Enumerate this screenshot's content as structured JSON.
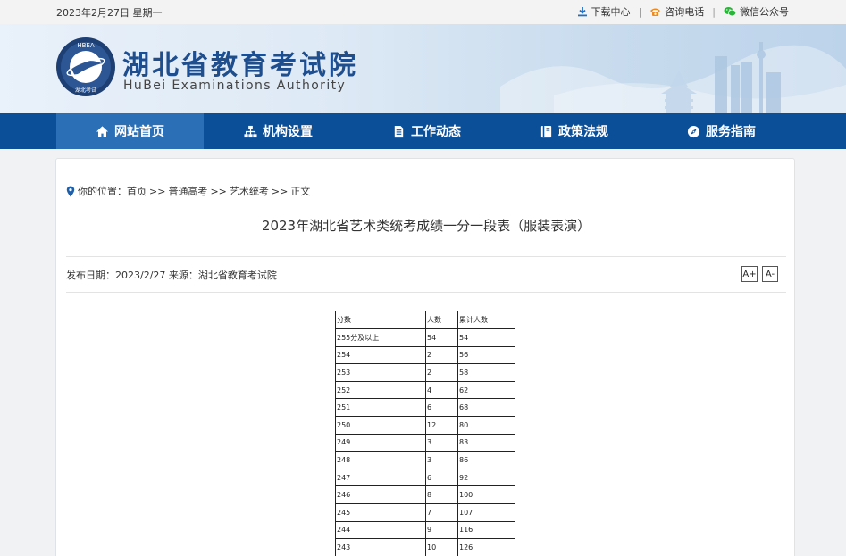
{
  "topbar": {
    "date": "2023年2月27日 星期一",
    "download_label": "下载中心",
    "phone_label": "咨询电话",
    "wechat_label": "微信公众号",
    "separator": "|"
  },
  "header": {
    "title_cn": "湖北省教育考试院",
    "title_en": "HuBei Examinations Authority",
    "logo_text_top": "HBEA",
    "logo_text_bottom": "湖北考试"
  },
  "nav": {
    "items": [
      {
        "label": "网站首页",
        "icon": "home-icon"
      },
      {
        "label": "机构设置",
        "icon": "org-chart-icon"
      },
      {
        "label": "工作动态",
        "icon": "document-icon"
      },
      {
        "label": "政策法规",
        "icon": "book-icon"
      },
      {
        "label": "服务指南",
        "icon": "compass-icon"
      }
    ]
  },
  "breadcrumb": {
    "prefix": "你的位置：",
    "items": [
      "首页",
      "普通高考",
      "艺术统考",
      "正文"
    ],
    "separator": ">>"
  },
  "article": {
    "title": "2023年湖北省艺术类统考成绩一分一段表（服装表演）",
    "meta": "发布日期：2023/2/27 来源：湖北省教育考试院",
    "font_increase": "A+",
    "font_decrease": "A-"
  },
  "table": {
    "headers": [
      "分数",
      "人数",
      "累计人数"
    ],
    "rows": [
      [
        "255分及以上",
        "54",
        "54"
      ],
      [
        "254",
        "2",
        "56"
      ],
      [
        "253",
        "2",
        "58"
      ],
      [
        "252",
        "4",
        "62"
      ],
      [
        "251",
        "6",
        "68"
      ],
      [
        "250",
        "12",
        "80"
      ],
      [
        "249",
        "3",
        "83"
      ],
      [
        "248",
        "3",
        "86"
      ],
      [
        "247",
        "6",
        "92"
      ],
      [
        "246",
        "8",
        "100"
      ],
      [
        "245",
        "7",
        "107"
      ],
      [
        "244",
        "9",
        "116"
      ],
      [
        "243",
        "10",
        "126"
      ]
    ]
  },
  "colors": {
    "nav_bg": "#0c4f99",
    "nav_active": "#2b6fb6",
    "title_blue": "#1f4e8e"
  }
}
